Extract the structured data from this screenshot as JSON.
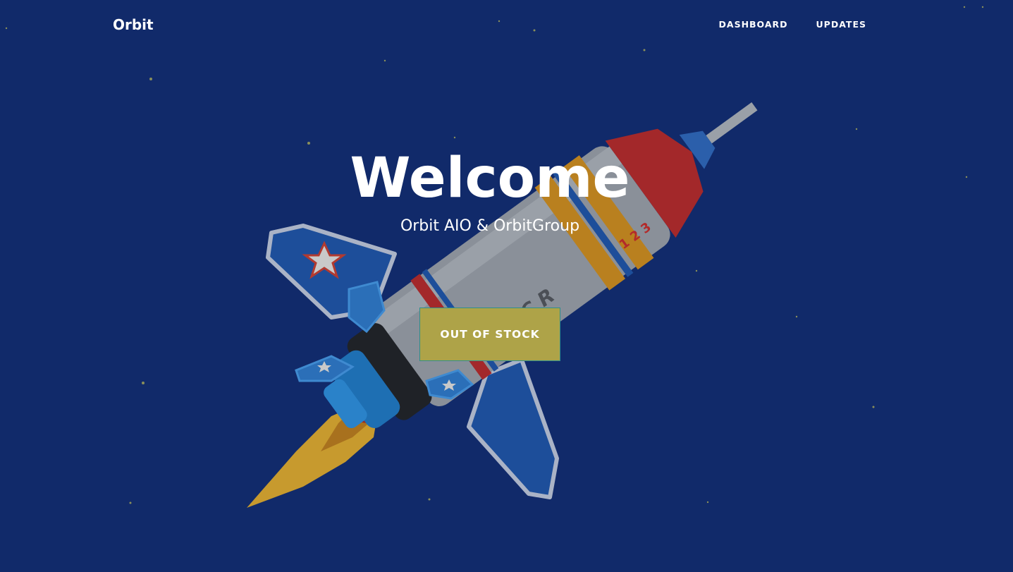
{
  "nav": {
    "brand": "Orbit",
    "links": [
      "DASHBOARD",
      "UPDATES"
    ]
  },
  "hero": {
    "title": "Welcome",
    "subtitle": "Orbit AIO & OrbitGroup",
    "cta_label": "OUT OF STOCK",
    "background_image": "rocket-illustration"
  },
  "colors": {
    "background": "#112a6a",
    "cta_background": "#aea348",
    "cta_border": "#2f8f8c",
    "text": "#ffffff"
  }
}
